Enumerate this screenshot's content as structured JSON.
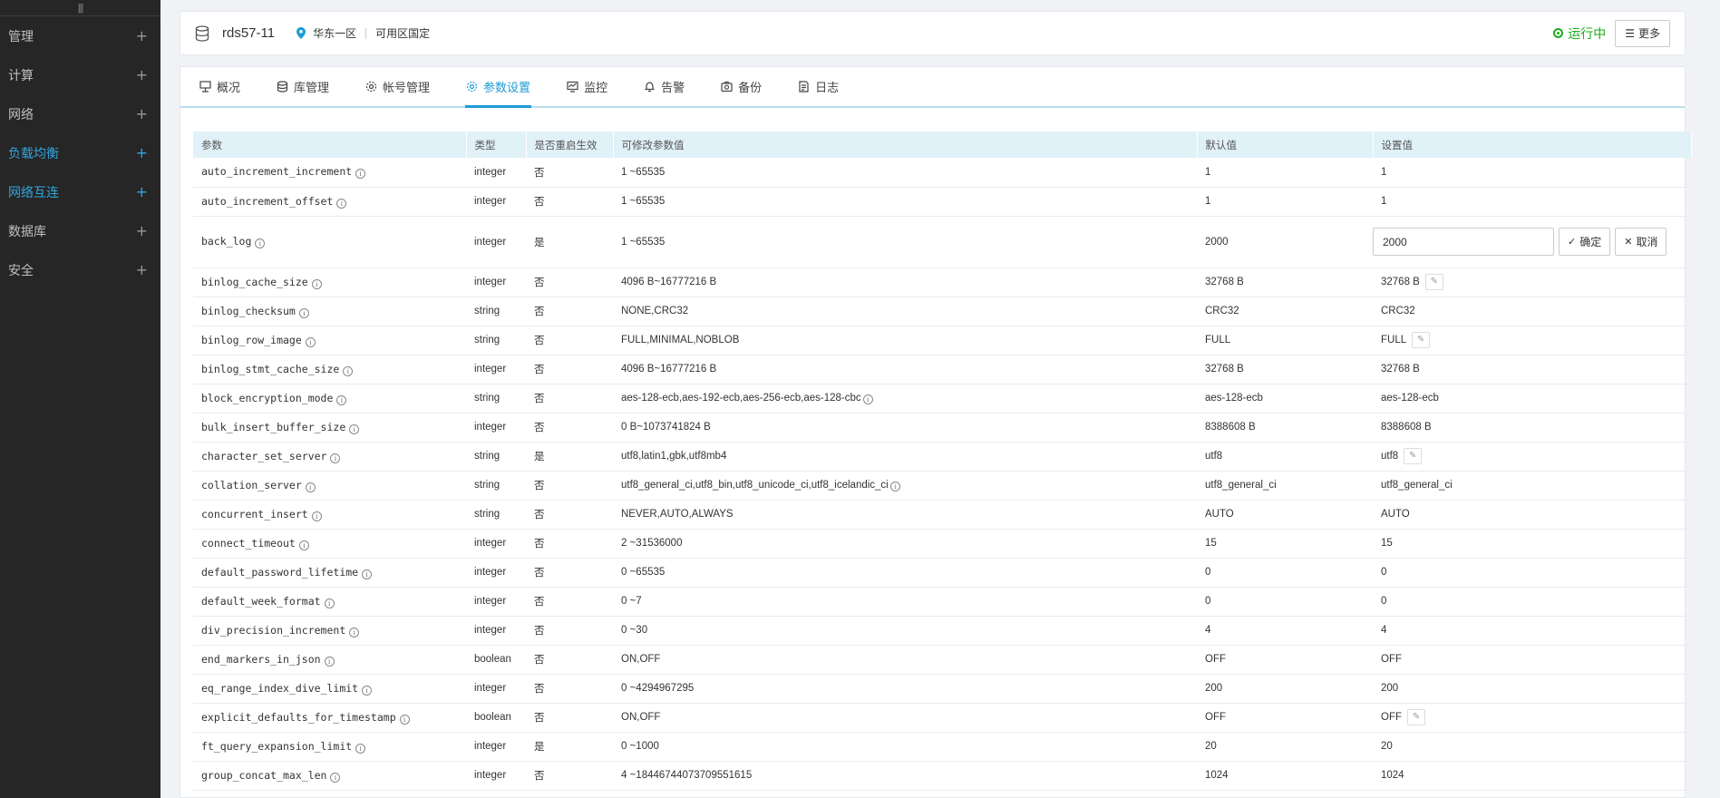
{
  "sidebar": {
    "items": [
      {
        "label": "管理",
        "accent": false
      },
      {
        "label": "计算",
        "accent": false
      },
      {
        "label": "网络",
        "accent": false
      },
      {
        "label": "负载均衡",
        "accent": true
      },
      {
        "label": "网络互连",
        "accent": true
      },
      {
        "label": "数据库",
        "accent": false
      },
      {
        "label": "安全",
        "accent": false
      }
    ]
  },
  "header": {
    "instance_name": "rds57-11",
    "region": "华东一区",
    "zone": "可用区国定",
    "status": "运行中",
    "more_label": "更多"
  },
  "tabs": [
    {
      "label": "概况",
      "icon": "server-icon"
    },
    {
      "label": "库管理",
      "icon": "database-icon"
    },
    {
      "label": "帐号管理",
      "icon": "gear-icon"
    },
    {
      "label": "参数设置",
      "icon": "gear-icon",
      "active": true
    },
    {
      "label": "监控",
      "icon": "monitor-icon"
    },
    {
      "label": "告警",
      "icon": "bell-icon"
    },
    {
      "label": "备份",
      "icon": "backup-icon"
    },
    {
      "label": "日志",
      "icon": "log-icon"
    }
  ],
  "table": {
    "columns": [
      "参数",
      "类型",
      "是否重启生效",
      "可修改参数值",
      "默认值",
      "设置值"
    ],
    "editing_row": 2,
    "edit_buttons": {
      "confirm": "确定",
      "cancel": "取消"
    },
    "rows": [
      {
        "name": "auto_increment_increment",
        "type": "integer",
        "restart": "否",
        "range": "1 ~65535",
        "range_info": false,
        "default": "1",
        "value": "1",
        "editable": false
      },
      {
        "name": "auto_increment_offset",
        "type": "integer",
        "restart": "否",
        "range": "1 ~65535",
        "range_info": false,
        "default": "1",
        "value": "1",
        "editable": false
      },
      {
        "name": "back_log",
        "type": "integer",
        "restart": "是",
        "range": "1 ~65535",
        "range_info": false,
        "default": "2000",
        "value": "2000",
        "editable": false
      },
      {
        "name": "binlog_cache_size",
        "type": "integer",
        "restart": "否",
        "range": "4096 B~16777216 B",
        "range_info": false,
        "default": "32768 B",
        "value": "32768 B",
        "editable": true
      },
      {
        "name": "binlog_checksum",
        "type": "string",
        "restart": "否",
        "range": "NONE,CRC32",
        "range_info": false,
        "default": "CRC32",
        "value": "CRC32",
        "editable": false
      },
      {
        "name": "binlog_row_image",
        "type": "string",
        "restart": "否",
        "range": "FULL,MINIMAL,NOBLOB",
        "range_info": false,
        "default": "FULL",
        "value": "FULL",
        "editable": true
      },
      {
        "name": "binlog_stmt_cache_size",
        "type": "integer",
        "restart": "否",
        "range": "4096 B~16777216 B",
        "range_info": false,
        "default": "32768 B",
        "value": "32768 B",
        "editable": false
      },
      {
        "name": "block_encryption_mode",
        "type": "string",
        "restart": "否",
        "range": "aes-128-ecb,aes-192-ecb,aes-256-ecb,aes-128-cbc",
        "range_info": true,
        "default": "aes-128-ecb",
        "value": "aes-128-ecb",
        "editable": false
      },
      {
        "name": "bulk_insert_buffer_size",
        "type": "integer",
        "restart": "否",
        "range": "0 B~1073741824 B",
        "range_info": false,
        "default": "8388608 B",
        "value": "8388608 B",
        "editable": false
      },
      {
        "name": "character_set_server",
        "type": "string",
        "restart": "是",
        "range": "utf8,latin1,gbk,utf8mb4",
        "range_info": false,
        "default": "utf8",
        "value": "utf8",
        "editable": true
      },
      {
        "name": "collation_server",
        "type": "string",
        "restart": "否",
        "range": "utf8_general_ci,utf8_bin,utf8_unicode_ci,utf8_icelandic_ci",
        "range_info": true,
        "default": "utf8_general_ci",
        "value": "utf8_general_ci",
        "editable": false
      },
      {
        "name": "concurrent_insert",
        "type": "string",
        "restart": "否",
        "range": "NEVER,AUTO,ALWAYS",
        "range_info": false,
        "default": "AUTO",
        "value": "AUTO",
        "editable": false
      },
      {
        "name": "connect_timeout",
        "type": "integer",
        "restart": "否",
        "range": "2 ~31536000",
        "range_info": false,
        "default": "15",
        "value": "15",
        "editable": false
      },
      {
        "name": "default_password_lifetime",
        "type": "integer",
        "restart": "否",
        "range": "0 ~65535",
        "range_info": false,
        "default": "0",
        "value": "0",
        "editable": false
      },
      {
        "name": "default_week_format",
        "type": "integer",
        "restart": "否",
        "range": "0 ~7",
        "range_info": false,
        "default": "0",
        "value": "0",
        "editable": false
      },
      {
        "name": "div_precision_increment",
        "type": "integer",
        "restart": "否",
        "range": "0 ~30",
        "range_info": false,
        "default": "4",
        "value": "4",
        "editable": false
      },
      {
        "name": "end_markers_in_json",
        "type": "boolean",
        "restart": "否",
        "range": "ON,OFF",
        "range_info": false,
        "default": "OFF",
        "value": "OFF",
        "editable": false
      },
      {
        "name": "eq_range_index_dive_limit",
        "type": "integer",
        "restart": "否",
        "range": "0 ~4294967295",
        "range_info": false,
        "default": "200",
        "value": "200",
        "editable": false
      },
      {
        "name": "explicit_defaults_for_timestamp",
        "type": "boolean",
        "restart": "否",
        "range": "ON,OFF",
        "range_info": false,
        "default": "OFF",
        "value": "OFF",
        "editable": true
      },
      {
        "name": "ft_query_expansion_limit",
        "type": "integer",
        "restart": "是",
        "range": "0 ~1000",
        "range_info": false,
        "default": "20",
        "value": "20",
        "editable": false
      },
      {
        "name": "group_concat_max_len",
        "type": "integer",
        "restart": "否",
        "range": "4 ~18446744073709551615",
        "range_info": false,
        "default": "1024",
        "value": "1024",
        "editable": false
      }
    ]
  }
}
